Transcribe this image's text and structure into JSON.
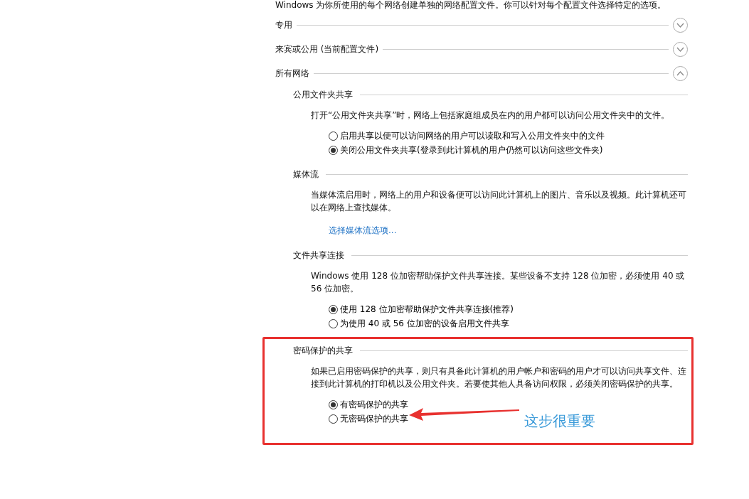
{
  "intro": "Windows 为你所使用的每个网络创建单独的网络配置文件。你可以针对每个配置文件选择特定的选项。",
  "profiles": [
    {
      "title": "专用",
      "expanded": false
    },
    {
      "title": "来宾或公用 (当前配置文件)",
      "expanded": false
    },
    {
      "title": "所有网络",
      "expanded": true,
      "sections": [
        {
          "title": "公用文件夹共享",
          "highlighted": false,
          "description": "打开“公用文件夹共享”时，网络上包括家庭组成员在内的用户都可以访问公用文件夹中的文件。",
          "options": [
            {
              "label": "启用共享以便可以访问网络的用户可以读取和写入公用文件夹中的文件",
              "selected": false
            },
            {
              "label": "关闭公用文件夹共享(登录到此计算机的用户仍然可以访问这些文件夹)",
              "selected": true
            }
          ]
        },
        {
          "title": "媒体流",
          "highlighted": false,
          "description": "当媒体流启用时，网络上的用户和设备便可以访问此计算机上的图片、音乐以及视频。此计算机还可以在网络上查找媒体。",
          "link": "选择媒体流选项..."
        },
        {
          "title": "文件共享连接",
          "highlighted": false,
          "description": "Windows 使用 128 位加密帮助保护文件共享连接。某些设备不支持 128 位加密，必须使用 40 或 56 位加密。",
          "options": [
            {
              "label": "使用 128 位加密帮助保护文件共享连接(推荐)",
              "selected": true
            },
            {
              "label": "为使用 40 或 56 位加密的设备启用文件共享",
              "selected": false
            }
          ]
        },
        {
          "title": "密码保护的共享",
          "highlighted": true,
          "description": "如果已启用密码保护的共享，则只有具备此计算机的用户帐户和密码的用户才可以访问共享文件、连接到此计算机的打印机以及公用文件夹。若要使其他人具备访问权限，必须关闭密码保护的共享。",
          "options": [
            {
              "label": "有密码保护的共享",
              "selected": true
            },
            {
              "label": "无密码保护的共享",
              "selected": false
            }
          ],
          "annotation": "这步很重要"
        }
      ]
    }
  ]
}
